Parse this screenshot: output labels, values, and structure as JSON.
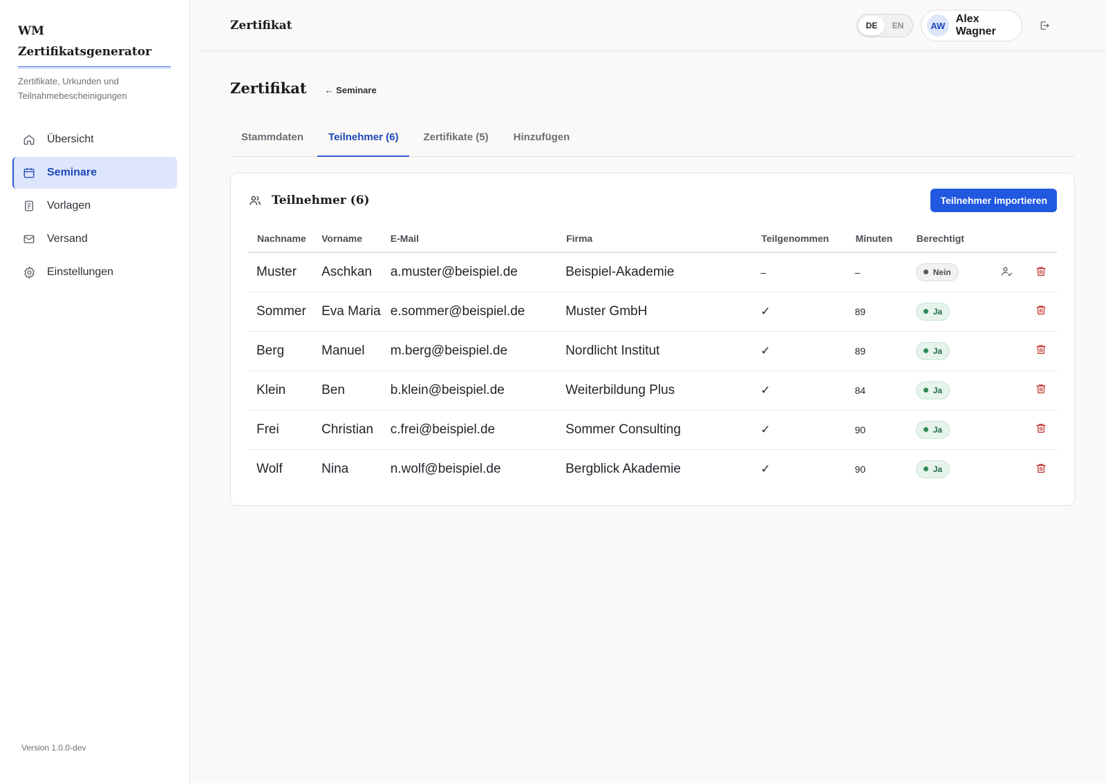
{
  "brand": {
    "title": "WM Zertifikatsgenerator",
    "subtitle": "Zertifikate, Urkunden und Teilnahmebescheinigungen"
  },
  "nav": [
    {
      "label": "Übersicht",
      "icon": "home-icon"
    },
    {
      "label": "Seminare",
      "icon": "calendar-icon",
      "active": true
    },
    {
      "label": "Vorlagen",
      "icon": "document-icon"
    },
    {
      "label": "Versand",
      "icon": "mail-icon"
    },
    {
      "label": "Einstellungen",
      "icon": "gear-icon"
    }
  ],
  "version": "Version 1.0.0-dev",
  "topbar": {
    "title": "Zertifikat",
    "lang": {
      "de": "DE",
      "en": "EN",
      "active": "DE"
    },
    "user": {
      "initials": "AW",
      "name": "Alex Wagner"
    }
  },
  "page": {
    "title": "Zertifikat",
    "back_label": "← Seminare"
  },
  "tabs": [
    {
      "label": "Stammdaten"
    },
    {
      "label": "Teilnehmer (6)",
      "active": true
    },
    {
      "label": "Zertifikate (5)"
    },
    {
      "label": "Hinzufügen"
    }
  ],
  "card": {
    "title": "Teilnehmer (6)",
    "import_label": "Teilnehmer importieren"
  },
  "table": {
    "headers": {
      "nachname": "Nachname",
      "vorname": "Vorname",
      "email": "E-Mail",
      "firma": "Firma",
      "teilgenommen": "Teilgenommen",
      "minuten": "Minuten",
      "berechtigt": "Berechtigt"
    },
    "rows": [
      {
        "nachname": "Muster",
        "vorname": "Aschkan",
        "email": "a.muster@beispiel.de",
        "firma": "Beispiel-Akademie",
        "teilgenommen": "–",
        "minuten": "–",
        "berechtigt": "Nein"
      },
      {
        "nachname": "Sommer",
        "vorname": "Eva Maria",
        "email": "e.sommer@beispiel.de",
        "firma": "Muster GmbH",
        "teilgenommen": "✓",
        "minuten": "89",
        "berechtigt": "Ja"
      },
      {
        "nachname": "Berg",
        "vorname": "Manuel",
        "email": "m.berg@beispiel.de",
        "firma": "Nordlicht Institut",
        "teilgenommen": "✓",
        "minuten": "89",
        "berechtigt": "Ja"
      },
      {
        "nachname": "Klein",
        "vorname": "Ben",
        "email": "b.klein@beispiel.de",
        "firma": "Weiterbildung Plus",
        "teilgenommen": "✓",
        "minuten": "84",
        "berechtigt": "Ja"
      },
      {
        "nachname": "Frei",
        "vorname": "Christian",
        "email": "c.frei@beispiel.de",
        "firma": "Sommer Consulting",
        "teilgenommen": "✓",
        "minuten": "90",
        "berechtigt": "Ja"
      },
      {
        "nachname": "Wolf",
        "vorname": "Nina",
        "email": "n.wolf@beispiel.de",
        "firma": "Bergblick Akademie",
        "teilgenommen": "✓",
        "minuten": "90",
        "berechtigt": "Ja"
      }
    ]
  },
  "colors": {
    "accent": "#2058e0",
    "active_nav_bg": "#dde6fa",
    "danger": "#c0342d",
    "success": "#2f8a57"
  }
}
